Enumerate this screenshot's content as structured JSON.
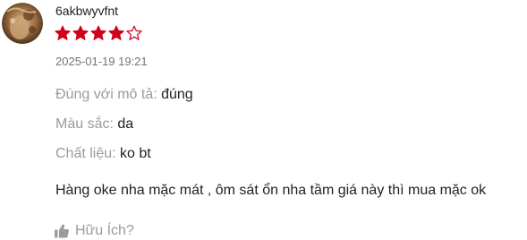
{
  "review": {
    "username": "6akbwyvfnt",
    "rating": 4,
    "max_rating": 5,
    "timestamp": "2025-01-19 19:21",
    "attributes": [
      {
        "label": "Đúng với mô tả:",
        "value": "đúng"
      },
      {
        "label": "Màu sắc:",
        "value": "da"
      },
      {
        "label": "Chất liệu:",
        "value": "ko bt"
      }
    ],
    "comment": "Hàng oke nha mặc mát , ôm sát ổn nha tầm giá này thì mua mặc ok",
    "helpful_label": "Hữu Ích?"
  },
  "colors": {
    "star_filled": "#d0011b",
    "muted_text": "#9b9b9b",
    "timestamp_text": "#757575",
    "body_text": "#222222"
  },
  "icons": {
    "avatar": "user-avatar-photo",
    "star_filled": "star-filled-icon",
    "star_empty": "star-outline-icon",
    "helpful": "thumbs-up-icon"
  }
}
